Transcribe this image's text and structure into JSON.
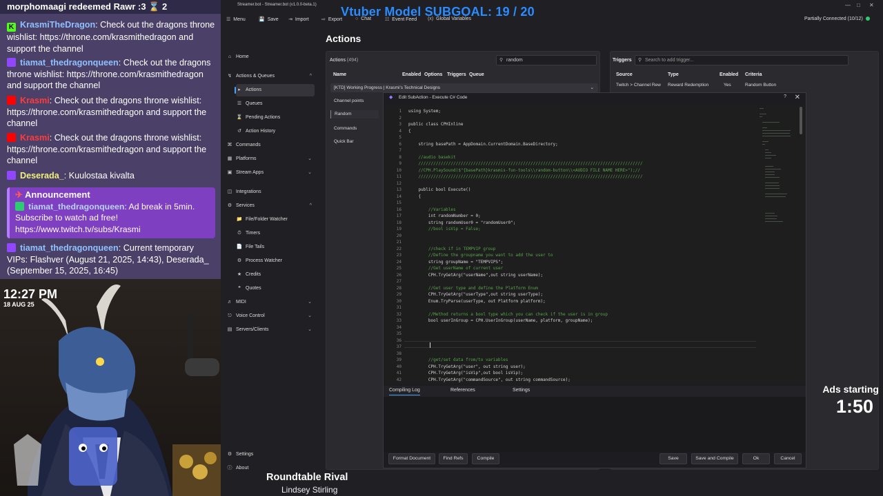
{
  "chat": {
    "top_banner": "morphomaagi redeemed Rawr :3 ⌛ 2",
    "messages": [
      {
        "platform": "kick",
        "user": "KrasmiTheDragon",
        "text": ": Check out the dragons throne wishlist: https://throne.com/krasmithedragon and support the channel"
      },
      {
        "platform": "twitch",
        "user": "tiamat_thedragonqueen",
        "text": ": Check out the dragons throne wishlist: https://throne.com/krasmithedragon and support the channel"
      },
      {
        "platform": "youtube",
        "user": "Krasmi",
        "text": ": Check out the dragons throne wishlist: https://throne.com/krasmithedragon and support the channel"
      },
      {
        "platform": "youtube",
        "user": "Krasmi",
        "text": ": Check out the dragons throne wishlist: https://throne.com/krasmithedragon and support the channel"
      },
      {
        "platform": "twitch",
        "user": "Deserada_",
        "text": ": Kuulostaa kivalta"
      },
      {
        "platform": "twitch",
        "user": "tiamat_thedragonqueen",
        "text": ": Current temporary VIPs: Flashver (August 21, 2025, 14:43), Deserada_ (September 15, 2025, 16:45)"
      }
    ],
    "announcement": {
      "title": "Announcement",
      "user": "tiamat_thedragonqueen",
      "text": ": Ad break in 5min. Subscribe to watch ad free! https://www.twitch.tv/subs/Krasmi"
    },
    "colors": {
      "user": "#8ec1ff",
      "yt_user": "#ff3b3b",
      "announcement_bg": "#7e3fc0"
    }
  },
  "clock": {
    "time": "12:27 PM",
    "date": "18 AUG 25"
  },
  "app": {
    "window_title": "Streamer.bot - Streamer.bot (v1.0.0-beta.1)",
    "subgoal": "Vtuber Model SUBGOAL: 19 / 20",
    "toolbar": [
      "Menu",
      "Save",
      "Import",
      "Export",
      "Chat",
      "Event Feed",
      "Global Variables"
    ],
    "connection": "Partially Connected (10/12)",
    "page_title": "Actions",
    "sidebar": {
      "home": "Home",
      "actions_queues": "Actions & Queues",
      "actions": "Actions",
      "queues": "Queues",
      "pending_actions": "Pending Actions",
      "action_history": "Action History",
      "commands": "Commands",
      "platforms": "Platforms",
      "stream_apps": "Stream Apps",
      "integrations": "Integrations",
      "services": "Services",
      "file_folder_watcher": "File/Folder Watcher",
      "timers": "Timers",
      "file_tails": "File Tails",
      "process_watcher": "Process Watcher",
      "credits": "Credits",
      "quotes": "Quotes",
      "midi": "MIDI",
      "voice_control": "Voice Control",
      "servers_clients": "Servers/Clients",
      "settings": "Settings",
      "about": "About"
    },
    "actions_panel": {
      "label": "Actions",
      "count": "(494)",
      "search_value": "random",
      "columns": [
        "Name",
        "Enabled",
        "Options",
        "Triggers",
        "Queue"
      ],
      "group": "[KTD] Working Progress | Krasmi's Technical Designs",
      "sub_groups": [
        "Channel points",
        "Random",
        "Commands",
        "Quick Bar"
      ]
    },
    "triggers_panel": {
      "label": "Triggers",
      "search_placeholder": "Search to add trigger...",
      "columns": [
        "Source",
        "Type",
        "Enabled",
        "Criteria"
      ],
      "row": {
        "source": "Twitch > Channel Rew",
        "type": "Reward Redemption",
        "enabled": "Yes",
        "criteria": "Random Button"
      }
    }
  },
  "editor": {
    "title": "Edit SubAction - Execute C# Code",
    "lines": [
      {
        "n": "1",
        "t": "using System;",
        "c": "kw"
      },
      {
        "n": "2",
        "t": "",
        "c": ""
      },
      {
        "n": "3",
        "t": "public class CPHInline",
        "c": "kw"
      },
      {
        "n": "4",
        "t": "{",
        "c": ""
      },
      {
        "n": "5",
        "t": "",
        "c": ""
      },
      {
        "n": "6",
        "t": "    string basePath = AppDomain.CurrentDomain.BaseDirectory;",
        "c": ""
      },
      {
        "n": "7",
        "t": "",
        "c": ""
      },
      {
        "n": "8",
        "t": "    //audio basekit",
        "c": "cmt"
      },
      {
        "n": "9",
        "t": "    //////////////////////////////////////////////////////////////////////////////////////////",
        "c": "cmt"
      },
      {
        "n": "10",
        "t": "    //CPH.PlaySound($\"{basePath}krasmis-fun-tools\\\\random-button\\\\<AUDIO FILE NAME HERE>\");//",
        "c": "cmt"
      },
      {
        "n": "11",
        "t": "    //////////////////////////////////////////////////////////////////////////////////////////",
        "c": "cmt"
      },
      {
        "n": "12",
        "t": "",
        "c": ""
      },
      {
        "n": "13",
        "t": "    public bool Execute()",
        "c": ""
      },
      {
        "n": "14",
        "t": "    {",
        "c": ""
      },
      {
        "n": "15",
        "t": "",
        "c": ""
      },
      {
        "n": "16",
        "t": "        //Variables",
        "c": "cmt"
      },
      {
        "n": "17",
        "t": "        int randomNumber = 0;",
        "c": ""
      },
      {
        "n": "18",
        "t": "        string randomUser0 = \"randomUser0\";",
        "c": ""
      },
      {
        "n": "19",
        "t": "        //bool isVip = False;",
        "c": "cmt"
      },
      {
        "n": "20",
        "t": "",
        "c": ""
      },
      {
        "n": "21",
        "t": "",
        "c": ""
      },
      {
        "n": "22",
        "t": "        //check if in TEMPVIP group",
        "c": "cmt"
      },
      {
        "n": "23",
        "t": "        //Define the groupname you want to add the user to",
        "c": "cmt"
      },
      {
        "n": "24",
        "t": "        string groupName = \"TEMPVIPS\";",
        "c": ""
      },
      {
        "n": "25",
        "t": "        //Get userName of current user",
        "c": "cmt"
      },
      {
        "n": "26",
        "t": "        CPH.TryGetArg(\"userName\",out string userName);",
        "c": ""
      },
      {
        "n": "27",
        "t": "",
        "c": ""
      },
      {
        "n": "28",
        "t": "        //Get user type and define the Platform Enum",
        "c": "cmt"
      },
      {
        "n": "29",
        "t": "        CPH.TryGetArg(\"userType\",out string userType);",
        "c": ""
      },
      {
        "n": "30",
        "t": "        Enum.TryParse(userType, out Platform platform);",
        "c": ""
      },
      {
        "n": "31",
        "t": "",
        "c": ""
      },
      {
        "n": "32",
        "t": "        //Method returns a bool type which you can check if the user is in group",
        "c": "cmt"
      },
      {
        "n": "33",
        "t": "        bool userInGroup = CPH.UserInGroup(userName, platform, groupName);",
        "c": ""
      },
      {
        "n": "34",
        "t": "",
        "c": ""
      },
      {
        "n": "35",
        "t": "",
        "c": ""
      },
      {
        "n": "36",
        "t": "",
        "c": ""
      },
      {
        "n": "37",
        "t": "",
        "c": ""
      },
      {
        "n": "38",
        "t": "",
        "c": ""
      },
      {
        "n": "39",
        "t": "        //get/set data from/to variables",
        "c": "cmt"
      },
      {
        "n": "40",
        "t": "        CPH.TryGetArg(\"user\", out string user);",
        "c": ""
      },
      {
        "n": "41",
        "t": "        CPH.TryGetArg(\"isVip\",out bool isVip);",
        "c": ""
      },
      {
        "n": "42",
        "t": "        CPH.TryGetArg(\"commandSource\", out string commandSource);",
        "c": ""
      }
    ],
    "tabs": [
      "Compiling Log",
      "References",
      "Settings"
    ],
    "buttons": {
      "format": "Format Document",
      "find_refs": "Find Refs",
      "compile": "Compile",
      "save": "Save",
      "save_compile": "Save and Compile",
      "ok": "Ok",
      "cancel": "Cancel"
    }
  },
  "ads": {
    "label": "Ads starting",
    "time": "1:50"
  },
  "now_playing": {
    "title": "Roundtable Rival",
    "artist": "Lindsey Stirling"
  }
}
